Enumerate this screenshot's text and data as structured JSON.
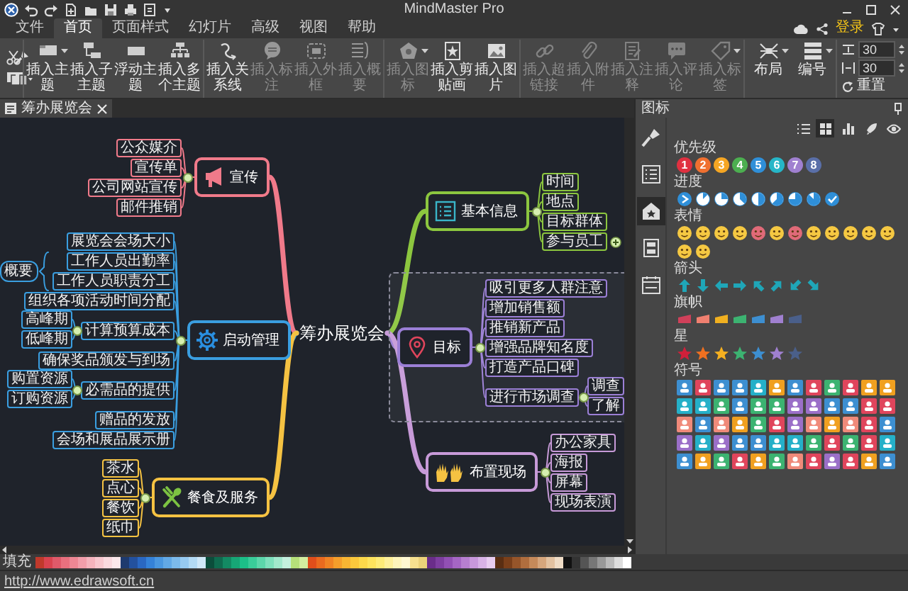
{
  "window": {
    "title": "MindMaster Pro"
  },
  "menu": [
    {
      "label": "文件",
      "selected": false
    },
    {
      "label": "首页",
      "selected": true
    },
    {
      "label": "页面样式",
      "selected": false
    },
    {
      "label": "幻灯片",
      "selected": false
    },
    {
      "label": "高级",
      "selected": false
    },
    {
      "label": "视图",
      "selected": false
    },
    {
      "label": "帮助",
      "selected": false
    }
  ],
  "account": {
    "label": "登录"
  },
  "ribbon": {
    "groups": [
      {
        "buttons": [
          {
            "label": "插入主题",
            "disabled": false,
            "dropdown": true
          },
          {
            "label": "插入子主题",
            "disabled": false,
            "dropdown": false
          },
          {
            "label": "浮动主题",
            "disabled": false,
            "dropdown": false
          },
          {
            "label": "插入多个主题",
            "disabled": false,
            "dropdown": false
          }
        ]
      },
      {
        "buttons": [
          {
            "label": "插入关系线",
            "disabled": false,
            "dropdown": false
          },
          {
            "label": "插入标注",
            "disabled": true,
            "dropdown": false
          },
          {
            "label": "插入外框",
            "disabled": true,
            "dropdown": false
          },
          {
            "label": "插入概要",
            "disabled": true,
            "dropdown": false
          }
        ]
      },
      {
        "buttons": [
          {
            "label": "插入图标",
            "disabled": true,
            "dropdown": true
          },
          {
            "label": "插入剪贴画",
            "disabled": false,
            "dropdown": false
          },
          {
            "label": "插入图片",
            "disabled": false,
            "dropdown": false
          }
        ]
      },
      {
        "buttons": [
          {
            "label": "插入超链接",
            "disabled": true,
            "dropdown": false
          },
          {
            "label": "插入附件",
            "disabled": true,
            "dropdown": false
          },
          {
            "label": "插入注释",
            "disabled": true,
            "dropdown": false
          },
          {
            "label": "插入评论",
            "disabled": true,
            "dropdown": false
          },
          {
            "label": "插入标签",
            "disabled": true,
            "dropdown": true
          }
        ]
      },
      {
        "buttons": [
          {
            "label": "布局",
            "disabled": false,
            "dropdown": true
          },
          {
            "label": "编号",
            "disabled": false,
            "dropdown": true
          }
        ]
      }
    ],
    "spacing": {
      "fields": [
        {
          "value": "30"
        },
        {
          "value": "30"
        }
      ],
      "reset": "重置"
    }
  },
  "document_tab": {
    "title": "筹办展览会"
  },
  "mind_map": {
    "center": "筹办展览会",
    "branches": [
      {
        "text": "宣传",
        "color": "#f07a8a",
        "boundary": false,
        "children": [
          {
            "text": "公众媒介"
          },
          {
            "text": "宣传单"
          },
          {
            "text": "公司网站宣传"
          },
          {
            "text": "邮件推销"
          }
        ]
      },
      {
        "text": "启动管理",
        "color": "#3a9ee0",
        "boundary": false,
        "summary": {
          "text": "概要"
        },
        "children": [
          {
            "text": "展览会会场大小",
            "summarized": false
          },
          {
            "text": "工作人员出勤率",
            "summarized": true
          },
          {
            "text": "工作人员职责分工",
            "summarized": true
          },
          {
            "text": "组织各项活动时间分配",
            "summarized": false
          },
          {
            "text": "计算预算成本",
            "summarized": false,
            "children": [
              {
                "text": "高峰期"
              },
              {
                "text": "低峰期"
              }
            ]
          },
          {
            "text": "确保奖品颁发与到场",
            "summarized": false
          },
          {
            "text": "必需品的提供",
            "summarized": false,
            "children": [
              {
                "text": "购置资源"
              },
              {
                "text": "订购资源"
              }
            ]
          },
          {
            "text": "赠品的发放",
            "summarized": false
          },
          {
            "text": "会场和展品展示册",
            "summarized": false
          }
        ]
      },
      {
        "text": "餐食及服务",
        "color": "#f5c242",
        "boundary": false,
        "children": [
          {
            "text": "茶水"
          },
          {
            "text": "点心"
          },
          {
            "text": "餐饮"
          },
          {
            "text": "纸巾"
          }
        ]
      },
      {
        "text": "基本信息",
        "color": "#8cc63f",
        "boundary": false,
        "children": [
          {
            "text": "时间",
            "collapsed": false
          },
          {
            "text": "地点",
            "collapsed": false
          },
          {
            "text": "目标群体",
            "collapsed": false
          },
          {
            "text": "参与员工",
            "collapsed": true
          }
        ]
      },
      {
        "text": "目标",
        "color": "#9b7fd6",
        "boundary": true,
        "children": [
          {
            "text": "吸引更多人群注意"
          },
          {
            "text": "增加销售额"
          },
          {
            "text": "推销新产品"
          },
          {
            "text": "增强品牌知名度"
          },
          {
            "text": "打造产品口碑"
          },
          {
            "text": "进行市场调查",
            "children": [
              {
                "text": "调查"
              },
              {
                "text": "了解"
              }
            ]
          }
        ]
      },
      {
        "text": "布置现场",
        "color": "#c79ad8",
        "boundary": false,
        "children": [
          {
            "text": "办公家具"
          },
          {
            "text": "海报"
          },
          {
            "text": "屏幕"
          },
          {
            "text": "现场表演"
          }
        ]
      }
    ]
  },
  "panel": {
    "title": "图标",
    "side_tabs": [
      {
        "selected": false
      },
      {
        "selected": false
      },
      {
        "selected": true
      },
      {
        "selected": false
      },
      {
        "selected": false
      }
    ],
    "views": [
      {
        "selected": false
      },
      {
        "selected": true
      },
      {
        "selected": false
      },
      {
        "selected": false
      },
      {
        "selected": false
      }
    ],
    "sections": [
      {
        "title": "优先级",
        "kind": "priority",
        "items": [
          {
            "text": "1",
            "color": "#e03040"
          },
          {
            "text": "2",
            "color": "#f07030"
          },
          {
            "text": "3",
            "color": "#f5a623"
          },
          {
            "text": "4",
            "color": "#4caf50"
          },
          {
            "text": "5",
            "color": "#2f8fd8"
          },
          {
            "text": "6",
            "color": "#26b6c8"
          },
          {
            "text": "7",
            "color": "#a080d0"
          },
          {
            "text": "8",
            "color": "#5a6fa8"
          }
        ]
      },
      {
        "title": "进度",
        "kind": "progress",
        "items": [
          {
            "kind": "start"
          },
          {
            "kind": "eighth"
          },
          {
            "kind": "quarter"
          },
          {
            "kind": "three-eighths"
          },
          {
            "kind": "half"
          },
          {
            "kind": "five-eighths"
          },
          {
            "kind": "three-quarters"
          },
          {
            "kind": "seven-eighths"
          },
          {
            "kind": "done"
          }
        ]
      },
      {
        "title": "表情",
        "kind": "faces",
        "items": [
          {
            "color": "#f5c842"
          },
          {
            "color": "#f5c842"
          },
          {
            "color": "#f5c842"
          },
          {
            "color": "#f5c842"
          },
          {
            "color": "#e06a78"
          },
          {
            "color": "#f5c842"
          },
          {
            "color": "#e06a78"
          },
          {
            "color": "#f5c842"
          },
          {
            "color": "#f5c842"
          },
          {
            "color": "#f5c842"
          },
          {
            "color": "#f5c842"
          },
          {
            "color": "#f5c842"
          },
          {
            "color": "#f5c842"
          },
          {
            "color": "#f5c842"
          }
        ]
      },
      {
        "title": "箭头",
        "kind": "arrows",
        "items": [
          {
            "kind": "up"
          },
          {
            "kind": "down"
          },
          {
            "kind": "left"
          },
          {
            "kind": "right"
          },
          {
            "kind": "up-left"
          },
          {
            "kind": "up-right"
          },
          {
            "kind": "down-left"
          },
          {
            "kind": "down-right"
          }
        ]
      },
      {
        "title": "旗帜",
        "kind": "flags",
        "items": [
          {
            "color": "#d0405a"
          },
          {
            "color": "#f08070"
          },
          {
            "color": "#f0b020"
          },
          {
            "color": "#3cb371"
          },
          {
            "color": "#3d8fd1"
          },
          {
            "color": "#a080d0"
          },
          {
            "color": "#4a5f8a"
          }
        ]
      },
      {
        "title": "星",
        "kind": "stars",
        "items": [
          {
            "color": "#d0203a"
          },
          {
            "color": "#f07020"
          },
          {
            "color": "#f5b020"
          },
          {
            "color": "#3cb371"
          },
          {
            "color": "#3d8fd1"
          },
          {
            "color": "#a080d0"
          },
          {
            "color": "#4a5f8a"
          }
        ]
      },
      {
        "title": "符号",
        "kind": "symbols",
        "items": [
          {
            "color": "#3d8fd1"
          },
          {
            "color": "#e0455c"
          },
          {
            "color": "#3d8fd1"
          },
          {
            "color": "#3d8fd1"
          },
          {
            "color": "#25b0c8"
          },
          {
            "color": "#f0a020"
          },
          {
            "color": "#3d8fd1"
          },
          {
            "color": "#e0455c"
          },
          {
            "color": "#3cb371"
          },
          {
            "color": "#e0455c"
          },
          {
            "color": "#f0a020"
          },
          {
            "color": "#f0a020"
          },
          {
            "color": "#25b0c8"
          },
          {
            "color": "#25b0c8"
          },
          {
            "color": "#3cb371"
          },
          {
            "color": "#3d8fd1"
          },
          {
            "color": "#3cb371"
          },
          {
            "color": "#3cb371"
          },
          {
            "color": "#9b6fc8"
          },
          {
            "color": "#9b6fc8"
          },
          {
            "color": "#3d8fd1"
          },
          {
            "color": "#3d8fd1"
          },
          {
            "color": "#e0455c"
          },
          {
            "color": "#e0455c"
          },
          {
            "color": "#f08a7a"
          },
          {
            "color": "#3d8fd1"
          },
          {
            "color": "#f08a7a"
          },
          {
            "color": "#f0a020"
          },
          {
            "color": "#3cb371"
          },
          {
            "color": "#e0455c"
          },
          {
            "color": "#9b6fc8"
          },
          {
            "color": "#f08a7a"
          },
          {
            "color": "#f0a020"
          },
          {
            "color": "#f08a7a"
          },
          {
            "color": "#e0455c"
          },
          {
            "color": "#3d8fd1"
          },
          {
            "color": "#9b6fc8"
          },
          {
            "color": "#25b0c8"
          },
          {
            "color": "#9b6fc8"
          },
          {
            "color": "#3d8fd1"
          },
          {
            "color": "#3d8fd1"
          },
          {
            "color": "#25b0c8"
          },
          {
            "color": "#25b0c8"
          },
          {
            "color": "#3cb371"
          },
          {
            "color": "#e0455c"
          },
          {
            "color": "#3cb371"
          },
          {
            "color": "#e0455c"
          },
          {
            "color": "#25b0c8"
          },
          {
            "color": "#3d8fd1"
          },
          {
            "color": "#f0a020"
          },
          {
            "color": "#3cb371"
          },
          {
            "color": "#e0455c"
          },
          {
            "color": "#f0a020"
          },
          {
            "color": "#3cb371"
          },
          {
            "color": "#f08a7a"
          },
          {
            "color": "#e0455c"
          },
          {
            "color": "#9b6fc8"
          },
          {
            "color": "#e0455c"
          },
          {
            "color": "#f0a020"
          },
          {
            "color": "#3d8fd1"
          }
        ]
      }
    ]
  },
  "palette": {
    "label": "填充",
    "swatches": [
      {
        "color": "#c0392b"
      },
      {
        "color": "#d9434f"
      },
      {
        "color": "#e05a6a"
      },
      {
        "color": "#e8707e"
      },
      {
        "color": "#ee8794"
      },
      {
        "color": "#f29eaa"
      },
      {
        "color": "#f5b4bd"
      },
      {
        "color": "#f8c8cf"
      },
      {
        "color": "#fadadf"
      },
      {
        "color": "#fce9ec"
      },
      {
        "color": "#1e3a6e"
      },
      {
        "color": "#23519e"
      },
      {
        "color": "#2a68c2"
      },
      {
        "color": "#3582d8"
      },
      {
        "color": "#4a97e0"
      },
      {
        "color": "#62a9e6"
      },
      {
        "color": "#7cbaeb"
      },
      {
        "color": "#97caf0"
      },
      {
        "color": "#b3daf4"
      },
      {
        "color": "#d0e8f8"
      },
      {
        "color": "#0b4d3b"
      },
      {
        "color": "#0f6b4f"
      },
      {
        "color": "#138a63"
      },
      {
        "color": "#17a676"
      },
      {
        "color": "#1cbf88"
      },
      {
        "color": "#3acc99"
      },
      {
        "color": "#5cd6aa"
      },
      {
        "color": "#7fe0bc"
      },
      {
        "color": "#a2e8cc"
      },
      {
        "color": "#c4f0dd"
      },
      {
        "color": "#b6e07a"
      },
      {
        "color": "#d3ee9f"
      },
      {
        "color": "#e04e1b"
      },
      {
        "color": "#ea6a1f"
      },
      {
        "color": "#f08324"
      },
      {
        "color": "#f59e2b"
      },
      {
        "color": "#f8b533"
      },
      {
        "color": "#fac83c"
      },
      {
        "color": "#fcd84a"
      },
      {
        "color": "#fde35d"
      },
      {
        "color": "#fdeb78"
      },
      {
        "color": "#fef09a"
      },
      {
        "color": "#fef5bb"
      },
      {
        "color": "#fff8d2"
      },
      {
        "color": "#f7e08f"
      },
      {
        "color": "#ecd27a"
      },
      {
        "color": "#6a2d8a"
      },
      {
        "color": "#7e3ea0"
      },
      {
        "color": "#9250b4"
      },
      {
        "color": "#a566c4"
      },
      {
        "color": "#b77fd0"
      },
      {
        "color": "#c898db"
      },
      {
        "color": "#d8b2e6"
      },
      {
        "color": "#e8cdf0"
      },
      {
        "color": "#5a2e12"
      },
      {
        "color": "#7a3f1a"
      },
      {
        "color": "#96552a"
      },
      {
        "color": "#b06e3e"
      },
      {
        "color": "#c68a5a"
      },
      {
        "color": "#d6a67c"
      },
      {
        "color": "#e3c2a1"
      },
      {
        "color": "#efdcc6"
      },
      {
        "color": "#111111"
      },
      {
        "color": "#333333"
      },
      {
        "color": "#555555"
      },
      {
        "color": "#777777"
      },
      {
        "color": "#999999"
      },
      {
        "color": "#bbbbbb"
      },
      {
        "color": "#dddddd"
      },
      {
        "color": "#ffffff"
      }
    ]
  },
  "status_bar": {
    "url": "http://www.edrawsoft.cn"
  }
}
